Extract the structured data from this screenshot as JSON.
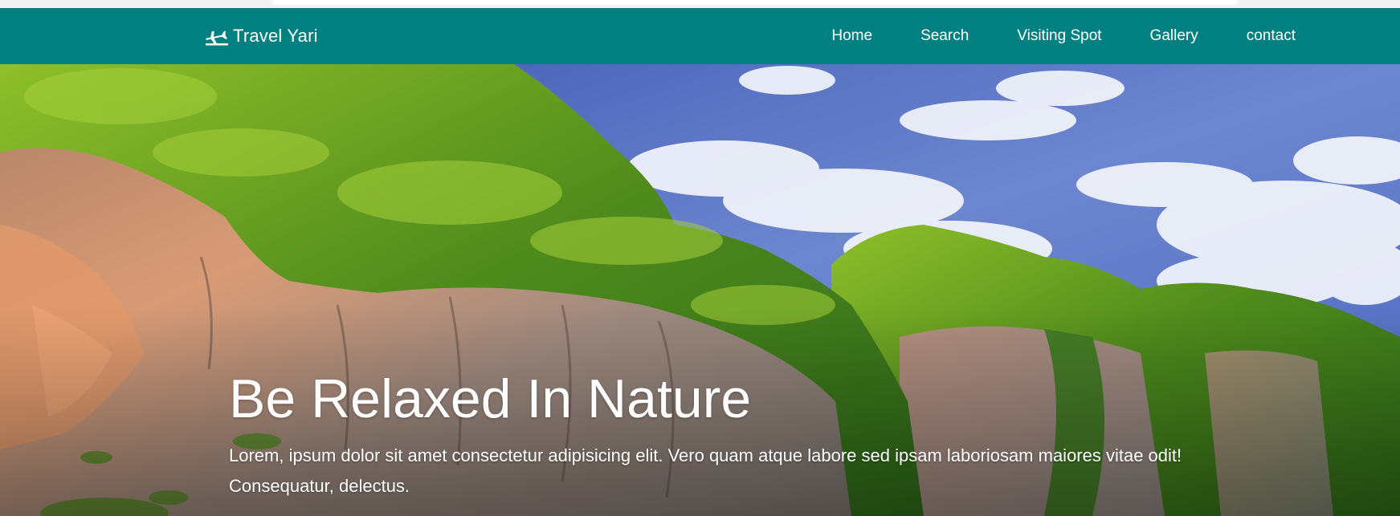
{
  "brand": {
    "name": "Travel Yari",
    "icon": "plane-icon"
  },
  "nav": {
    "items": [
      {
        "label": "Home"
      },
      {
        "label": "Search"
      },
      {
        "label": "Visiting Spot"
      },
      {
        "label": "Gallery"
      },
      {
        "label": "contact"
      }
    ]
  },
  "hero": {
    "title": "Be Relaxed In Nature",
    "description": "Lorem, ipsum dolor sit amet consectetur adipisicing elit. Vero quam atque labore sed ipsam laboriosam maiores vitae odit! Consequatur, delectus.",
    "image": "cliffs-and-sky-background"
  },
  "colors": {
    "navbar": "#008080",
    "text": "#ffffff",
    "sky": "#3b5bb5",
    "foliage": "#4f8a22",
    "rock": "#c98a6a"
  }
}
